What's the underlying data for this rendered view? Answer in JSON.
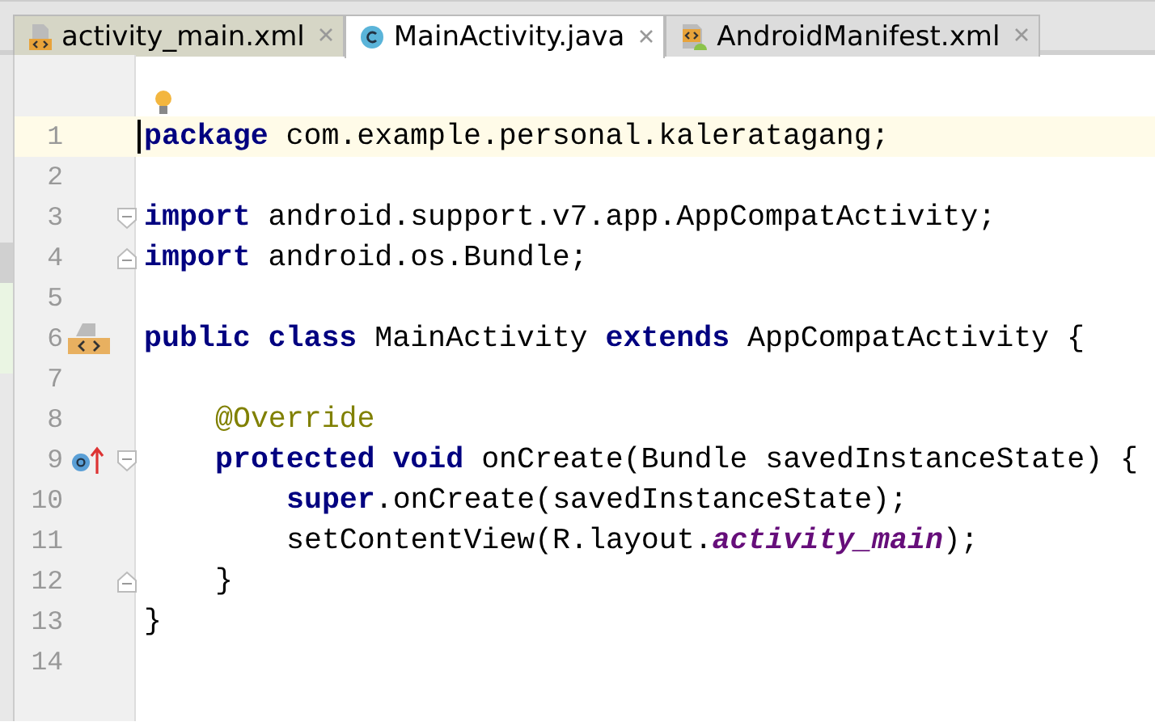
{
  "tabs": [
    {
      "label": "activity_main.xml",
      "kind": "layout",
      "selected": false
    },
    {
      "label": "MainActivity.java",
      "kind": "class",
      "selected": true
    },
    {
      "label": "AndroidManifest.xml",
      "kind": "manifest",
      "selected": false
    }
  ],
  "editor": {
    "lines": [
      {
        "number": "1",
        "current": true,
        "tokens": [
          {
            "kind": "kw",
            "text": "package"
          },
          {
            "kind": "txt",
            "text": " com.example.personal.kaleratagang;"
          }
        ]
      },
      {
        "number": "2",
        "current": false
      },
      {
        "number": "3",
        "current": false,
        "fold": {
          "kind": "start"
        },
        "tokens": [
          {
            "kind": "kw",
            "text": "import"
          },
          {
            "kind": "txt",
            "text": " android.support.v7.app.AppCompatActivity;"
          }
        ]
      },
      {
        "number": "4",
        "current": false,
        "fold": {
          "kind": "end"
        },
        "tokens": [
          {
            "kind": "kw",
            "text": "import"
          },
          {
            "kind": "txt",
            "text": " android.os.Bundle;"
          }
        ]
      },
      {
        "number": "5",
        "current": false
      },
      {
        "number": "6",
        "current": false,
        "gutter_icon": {
          "kind": "layout"
        },
        "tokens": [
          {
            "kind": "kw",
            "text": "public class"
          },
          {
            "kind": "txt",
            "text": " MainActivity "
          },
          {
            "kind": "kw",
            "text": "extends"
          },
          {
            "kind": "txt",
            "text": " AppCompatActivity {"
          }
        ]
      },
      {
        "number": "7",
        "current": false
      },
      {
        "number": "8",
        "current": false,
        "tokens": [
          {
            "kind": "ann",
            "text": "    @Override"
          }
        ]
      },
      {
        "number": "9",
        "current": false,
        "gutter_icon": {
          "kind": "override"
        },
        "fold": {
          "kind": "start"
        },
        "tokens": [
          {
            "kind": "kw",
            "text": "    protected void"
          },
          {
            "kind": "txt",
            "text": " onCreate(Bundle savedInstanceState) {"
          }
        ]
      },
      {
        "number": "10",
        "current": false,
        "tokens": [
          {
            "kind": "kw",
            "text": "        super"
          },
          {
            "kind": "txt",
            "text": ".onCreate(savedInstanceState);"
          }
        ]
      },
      {
        "number": "11",
        "current": false,
        "tokens": [
          {
            "kind": "txt",
            "text": "        setContentView(R.layout."
          },
          {
            "kind": "field",
            "text": "activity_main"
          },
          {
            "kind": "txt",
            "text": ");"
          }
        ]
      },
      {
        "number": "12",
        "current": false,
        "fold": {
          "kind": "end"
        },
        "tokens": [
          {
            "kind": "txt",
            "text": "    }"
          }
        ]
      },
      {
        "number": "13",
        "current": false,
        "tokens": [
          {
            "kind": "txt",
            "text": "}"
          }
        ]
      },
      {
        "number": "14",
        "current": false
      }
    ]
  }
}
